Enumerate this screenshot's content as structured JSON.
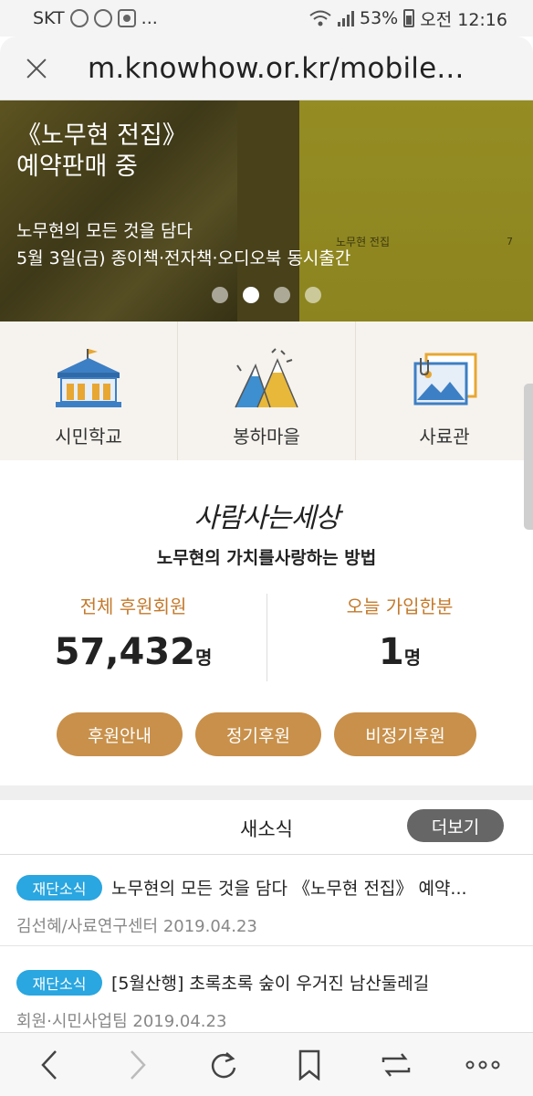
{
  "status_bar": {
    "carrier": "SKT",
    "battery": "53%",
    "time": "오전 12:16",
    "more": "..."
  },
  "url_bar": {
    "url": "m.knowhow.or.kr/mobile..."
  },
  "banner": {
    "title_line1": "《노무현 전집》",
    "title_line2": "예약판매 중",
    "sub_line1": "노무현의 모든 것을 담다",
    "sub_line2": "5월 3일(금) 종이책·전자책·오디오북 동시출간",
    "book_text": "노무현 전집",
    "book_number": "7",
    "slide_count": 4,
    "active_slide": 2
  },
  "categories": [
    {
      "label": "시민학교",
      "icon": "school-building-icon"
    },
    {
      "label": "봉하마을",
      "icon": "mountain-icon"
    },
    {
      "label": "사료관",
      "icon": "archive-photo-icon"
    }
  ],
  "support": {
    "slogan": "사람사는세상",
    "subtitle": "노무현의 가치를사랑하는 방법",
    "total_label": "전체 후원회원",
    "total_value": "57,432",
    "total_unit": "명",
    "today_label": "오늘 가입한분",
    "today_value": "1",
    "today_unit": "명",
    "buttons": [
      "후원안내",
      "정기후원",
      "비정기후원"
    ],
    "accent_color": "#c8904a",
    "label_color": "#c47a2c"
  },
  "news": {
    "title": "새소식",
    "more_label": "더보기",
    "items": [
      {
        "tag": "재단소식",
        "title": "노무현의 모든 것을 담다 《노무현 전집》 예약...",
        "meta": "김선혜/사료연구센터 2019.04.23"
      },
      {
        "tag": "재단소식",
        "title": "[5월산행] 초록초록 숲이 우거진 남산둘레길",
        "meta": "회원·시민사업팀 2019.04.23"
      }
    ],
    "tag_color": "#2aa6e0"
  },
  "toolbar": {
    "icons": [
      "back-icon",
      "forward-icon",
      "reload-icon",
      "bookmark-icon",
      "tabs-icon",
      "more-icon"
    ]
  }
}
